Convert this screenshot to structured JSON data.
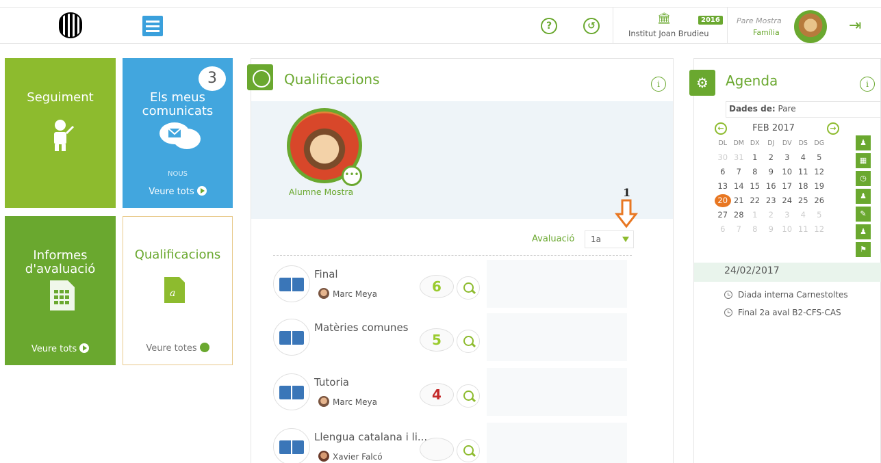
{
  "header": {
    "help_icon": "help-icon",
    "history_icon": "history-icon",
    "school_icon": "school-building-icon",
    "year": "2016",
    "school": "Institut Joan Brudieu",
    "user_name": "Pare Mostra",
    "user_role": "Família",
    "logout_icon": "logout-icon"
  },
  "tiles": {
    "seguiment": {
      "title": "Seguiment"
    },
    "comunicats": {
      "title": "Els meus comunicats",
      "count": "3",
      "nous": "NOUS",
      "more": "Veure tots"
    },
    "informes": {
      "title": "Informes d'avaluació",
      "more": "Veure tots"
    },
    "qualificacions": {
      "title": "Qualificacions",
      "more": "Veure totes"
    }
  },
  "qualificacions": {
    "title": "Qualificacions",
    "student": "Alumne Mostra",
    "eval_label": "Avaluació",
    "eval_value": "1a",
    "annotation": "1",
    "subjects": [
      {
        "name": "Final",
        "teacher": "Marc Meya",
        "grade": "6",
        "grade_color": "#9acb2e"
      },
      {
        "name": "Matèries comunes",
        "teacher": "",
        "grade": "5",
        "grade_color": "#9acb2e"
      },
      {
        "name": "Tutoria",
        "teacher": "Marc Meya",
        "grade": "4",
        "grade_color": "#c42a2a"
      },
      {
        "name": "Llengua catalana i li...",
        "teacher": "Xavier Falcó",
        "grade": "",
        "grade_color": ""
      }
    ]
  },
  "agenda": {
    "title": "Agenda",
    "dades_label": "Dades de:",
    "dades_value": "Pare",
    "month": "FEB 2017",
    "weekdays": [
      "DL",
      "DM",
      "DX",
      "DJ",
      "DV",
      "DS",
      "DG"
    ],
    "days": [
      "30",
      "31",
      "1",
      "2",
      "3",
      "4",
      "5",
      "6",
      "7",
      "8",
      "9",
      "10",
      "11",
      "12",
      "13",
      "14",
      "15",
      "16",
      "17",
      "18",
      "19",
      "20",
      "21",
      "22",
      "23",
      "24",
      "25",
      "26",
      "27",
      "28",
      "1",
      "2",
      "3",
      "4",
      "5",
      "6",
      "7",
      "8",
      "9",
      "10",
      "11",
      "12"
    ],
    "selected_date": "24/02/2017",
    "events": [
      "Diada interna Carnestoltes",
      "Final 2a aval B2-CFS-CAS"
    ]
  },
  "colors": {
    "green": "#6aa82f",
    "lime": "#8dbb2e",
    "blue": "#42a6de",
    "orange": "#e87722"
  }
}
